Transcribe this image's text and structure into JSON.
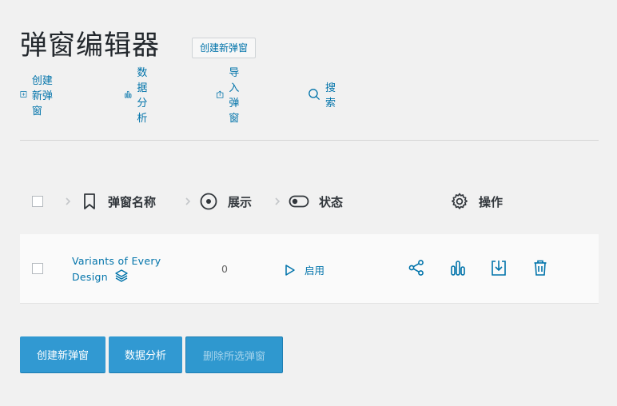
{
  "page": {
    "title": "弹窗编辑器",
    "title_badge": "创建新弹窗"
  },
  "toolbar": {
    "items": [
      {
        "label": "创建新弹窗",
        "icon": "plus-square-icon"
      },
      {
        "label": "数据分析",
        "icon": "bars-icon"
      },
      {
        "label": "导入弹窗",
        "icon": "upload-icon"
      },
      {
        "label": "搜索",
        "icon": "search-icon"
      }
    ]
  },
  "table": {
    "columns": [
      {
        "label": "弹窗名称",
        "icon": "bookmark-icon"
      },
      {
        "label": "展示",
        "icon": "circle-dot-icon"
      },
      {
        "label": "状态",
        "icon": "toggle-icon"
      },
      {
        "label": "操作",
        "icon": "gear-icon"
      }
    ],
    "rows": [
      {
        "name_line1": "Variants of Every",
        "name_line2": "Design",
        "views": "0",
        "status": "启用"
      }
    ]
  },
  "buttons": {
    "create": "创建新弹窗",
    "analytics": "数据分析",
    "delete_selected": "删除所选弹窗"
  },
  "colors": {
    "accent": "#0073aa",
    "button": "#3199d2",
    "background": "#f1f1f1"
  }
}
